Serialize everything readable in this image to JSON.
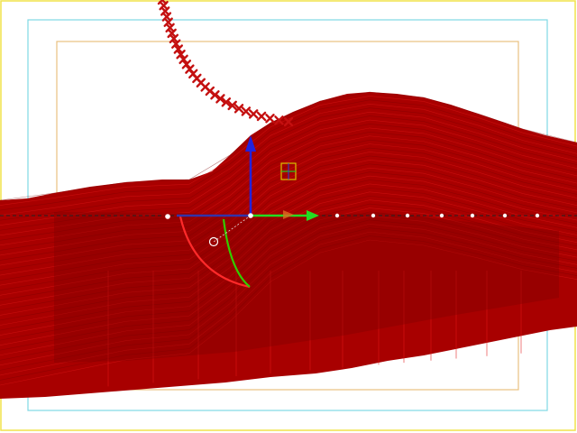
{
  "viewport": {
    "name": "3d-viewport",
    "background": "#ffffff"
  },
  "colors": {
    "mesh_fill": "#a80000",
    "mesh_line": "#e21818",
    "mesh_line_dark": "#7a0000",
    "curve_marker": "#c41010",
    "safe_frame_outer": "#f0e24a",
    "safe_frame_action": "#7fd8e4",
    "safe_frame_title": "#e8c080",
    "gizmo_x": "#22dd22",
    "gizmo_z": "#2222dd",
    "gizmo_y_in": "#3333aa",
    "gizmo_rot_red": "#ff2a2a",
    "gizmo_rot_green": "#33cc00",
    "axis_line": "#222222",
    "point_dot": "#ffffff"
  },
  "icons": {
    "gizmo": "transform-gizmo-icon",
    "plane_handle": "plane-handle-icon",
    "pivot": "pivot-circle-icon"
  }
}
